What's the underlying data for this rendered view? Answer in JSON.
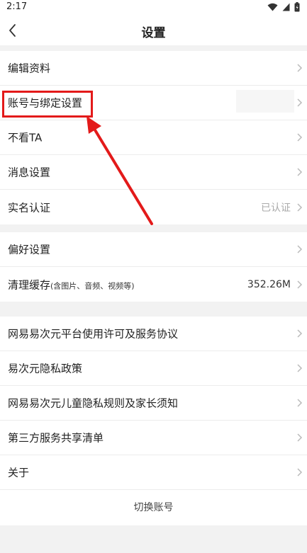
{
  "status_bar": {
    "time": "2:17"
  },
  "nav": {
    "title": "设置"
  },
  "groups": [
    {
      "rows": [
        {
          "label": "编辑资料",
          "value": ""
        },
        {
          "label": "账号与绑定设置",
          "value": ""
        },
        {
          "label": "不看TA",
          "value": ""
        },
        {
          "label": "消息设置",
          "value": ""
        },
        {
          "label": "实名认证",
          "value": "已认证"
        }
      ]
    },
    {
      "rows": [
        {
          "label": "偏好设置",
          "value": ""
        },
        {
          "label": "清理缓存",
          "sub": "(含图片、音频、视频等)",
          "value": "352.26M"
        }
      ]
    },
    {
      "rows": [
        {
          "label": "网易易次元平台使用许可及服务协议",
          "value": ""
        },
        {
          "label": "易次元隐私政策",
          "value": ""
        },
        {
          "label": "网易易次元儿童隐私规则及家长须知",
          "value": ""
        },
        {
          "label": "第三方服务共享清单",
          "value": ""
        },
        {
          "label": "关于",
          "value": ""
        }
      ],
      "footer": "切换账号"
    }
  ],
  "colors": {
    "annotation": "#e31a1a",
    "background": "#f2f2f2",
    "row_bg": "#ffffff"
  },
  "icons": {
    "back": "back-arrow-icon",
    "chevron": "chevron-right-icon",
    "wifi": "wifi-icon",
    "signal": "signal-icon",
    "battery": "battery-icon"
  }
}
